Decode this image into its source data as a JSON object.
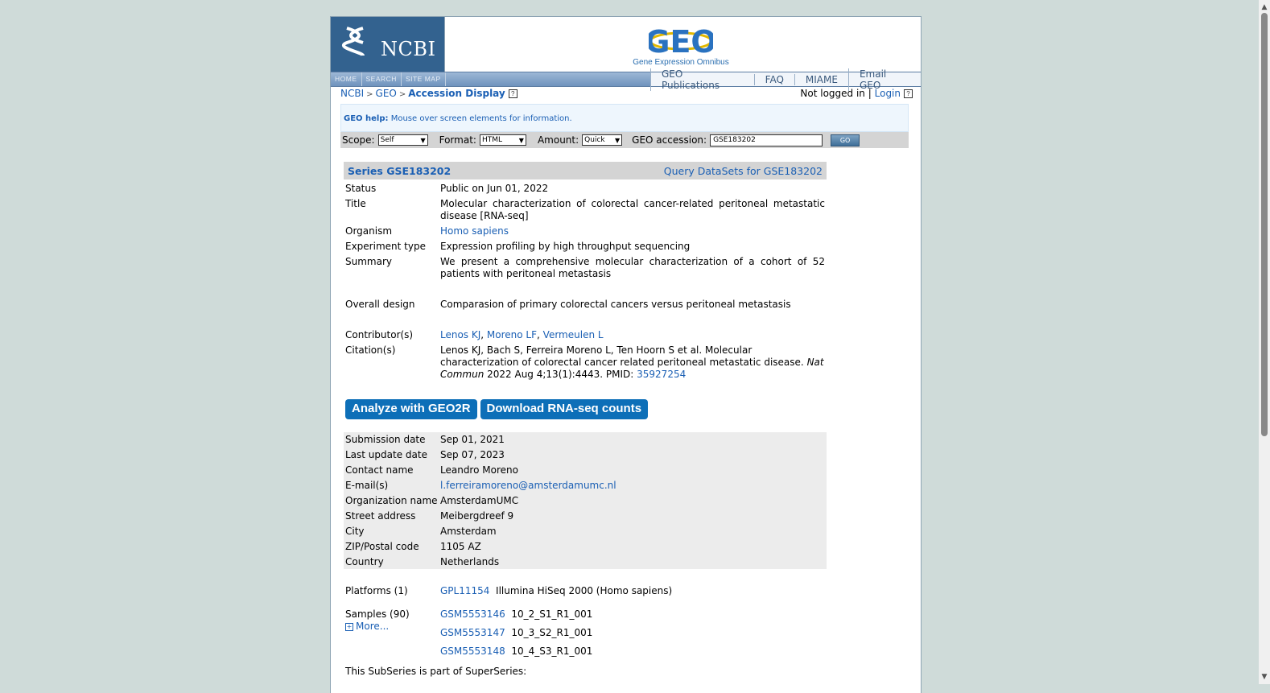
{
  "header": {
    "ncbi_logo": "NCBI",
    "geo_logo": "GEO",
    "geo_subtitle": "Gene Expression Omnibus",
    "left_nav": [
      "HOME",
      "SEARCH",
      "SITE MAP"
    ],
    "right_nav": [
      "GEO Publications",
      "FAQ",
      "MIAME",
      "Email GEO"
    ]
  },
  "breadcrumb": {
    "ncbi": "NCBI",
    "geo": "GEO",
    "current": "Accession Display",
    "sep": ">"
  },
  "login": {
    "status": "Not logged in",
    "sep": "|",
    "login": "Login"
  },
  "help": {
    "label": "GEO help:",
    "text": "Mouse over screen elements for information."
  },
  "form": {
    "scope_label": "Scope:",
    "scope_value": "Self",
    "format_label": "Format:",
    "format_value": "HTML",
    "amount_label": "Amount:",
    "amount_value": "Quick",
    "accession_label": "GEO accession:",
    "accession_value": "GSE183202",
    "go": "GO"
  },
  "series": {
    "title": "Series GSE183202",
    "query_link": "Query DataSets for GSE183202",
    "status_k": "Status",
    "status_v": "Public on Jun 01, 2022",
    "title_k": "Title",
    "title_v": "Molecular characterization of colorectal cancer-related peritoneal metastatic disease [RNA-seq]",
    "organism_k": "Organism",
    "organism_v": "Homo sapiens",
    "exp_k": "Experiment type",
    "exp_v": "Expression profiling by high throughput sequencing",
    "summary_k": "Summary",
    "summary_v": "We present a comprehensive molecular characterization of a cohort of 52 patients with peritoneal metastasis",
    "design_k": "Overall design",
    "design_v": "Comparasion of primary colorectal cancers versus peritoneal metastasis",
    "contrib_k": "Contributor(s)",
    "contributors": [
      "Lenos KJ",
      "Moreno LF",
      "Vermeulen L"
    ],
    "citation_k": "Citation(s)",
    "citation_text": "Lenos KJ, Bach S, Ferreira Moreno L, Ten Hoorn S et al. Molecular characterization of colorectal cancer related peritoneal metastatic disease.",
    "citation_journal": "Nat Commun",
    "citation_rest": "2022 Aug 4;13(1):4443. PMID:",
    "pmid": "35927254"
  },
  "buttons": {
    "geo2r": "Analyze with GEO2R",
    "download": "Download RNA-seq counts"
  },
  "contact": {
    "sub_k": "Submission date",
    "sub_v": "Sep 01, 2021",
    "upd_k": "Last update date",
    "upd_v": "Sep 07, 2023",
    "name_k": "Contact name",
    "name_v": "Leandro Moreno",
    "email_k": "E-mail(s)",
    "email_v": "l.ferreiramoreno@amsterdamumc.nl",
    "org_k": "Organization name",
    "org_v": "AmsterdamUMC",
    "street_k": "Street address",
    "street_v": "Meibergdreef 9",
    "city_k": "City",
    "city_v": "Amsterdam",
    "zip_k": "ZIP/Postal code",
    "zip_v": "1105 AZ",
    "country_k": "Country",
    "country_v": "Netherlands"
  },
  "platforms": {
    "k": "Platforms (1)",
    "id": "GPL11154",
    "desc": "Illumina HiSeq 2000 (Homo sapiens)"
  },
  "samples": {
    "k": "Samples (90)",
    "more": "More...",
    "items": [
      {
        "id": "GSM5553146",
        "desc": "10_2_S1_R1_001"
      },
      {
        "id": "GSM5553147",
        "desc": "10_3_S2_R1_001"
      },
      {
        "id": "GSM5553148",
        "desc": "10_4_S3_R1_001"
      }
    ]
  },
  "superseries": "This SubSeries is part of SuperSeries:"
}
